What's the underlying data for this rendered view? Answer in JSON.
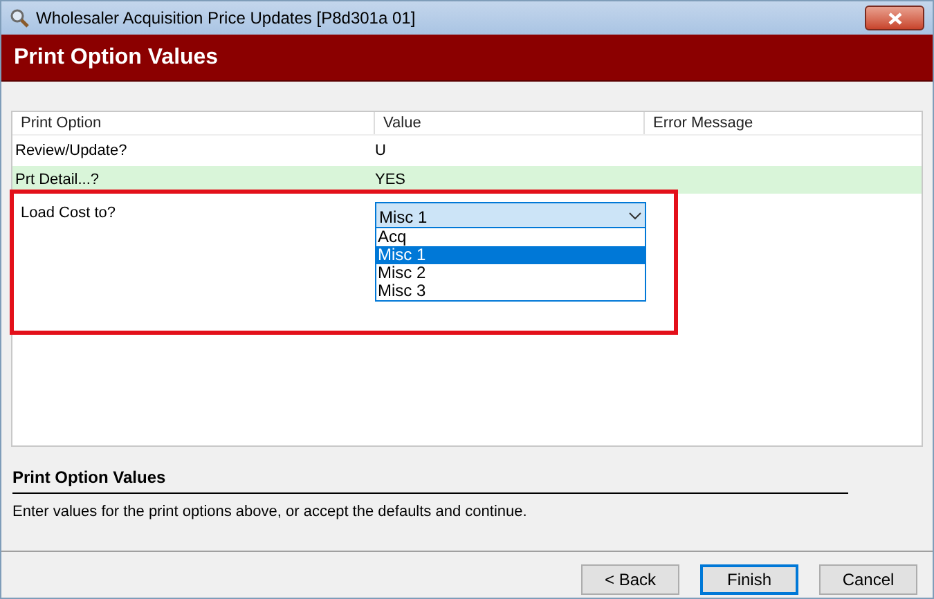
{
  "window": {
    "title": "Wholesaler Acquisition Price Updates [P8d301a 01]"
  },
  "header": {
    "title": "Print Option Values"
  },
  "table": {
    "columns": [
      "Print Option",
      "Value",
      "Error Message"
    ],
    "rows": [
      {
        "kind": "text",
        "option": "Review/Update?",
        "value": "U",
        "selected": false
      },
      {
        "kind": "text",
        "option": "Prt Detail...?",
        "value": "YES",
        "selected": true
      },
      {
        "kind": "dropdown",
        "option": "Load Cost to?",
        "value": "Misc 1",
        "selected": false,
        "expanded": true,
        "options": [
          {
            "label": "Acq",
            "selected": false
          },
          {
            "label": "Misc 1",
            "selected": true
          },
          {
            "label": "Misc 2",
            "selected": false
          },
          {
            "label": "Misc 3",
            "selected": false
          }
        ]
      }
    ]
  },
  "help": {
    "title": "Print Option Values",
    "text": "Enter values for the print options above, or accept the defaults and continue."
  },
  "buttons": [
    {
      "label": "< Back",
      "default": false
    },
    {
      "label": "Finish",
      "default": true
    },
    {
      "label": "Cancel",
      "default": false
    }
  ]
}
